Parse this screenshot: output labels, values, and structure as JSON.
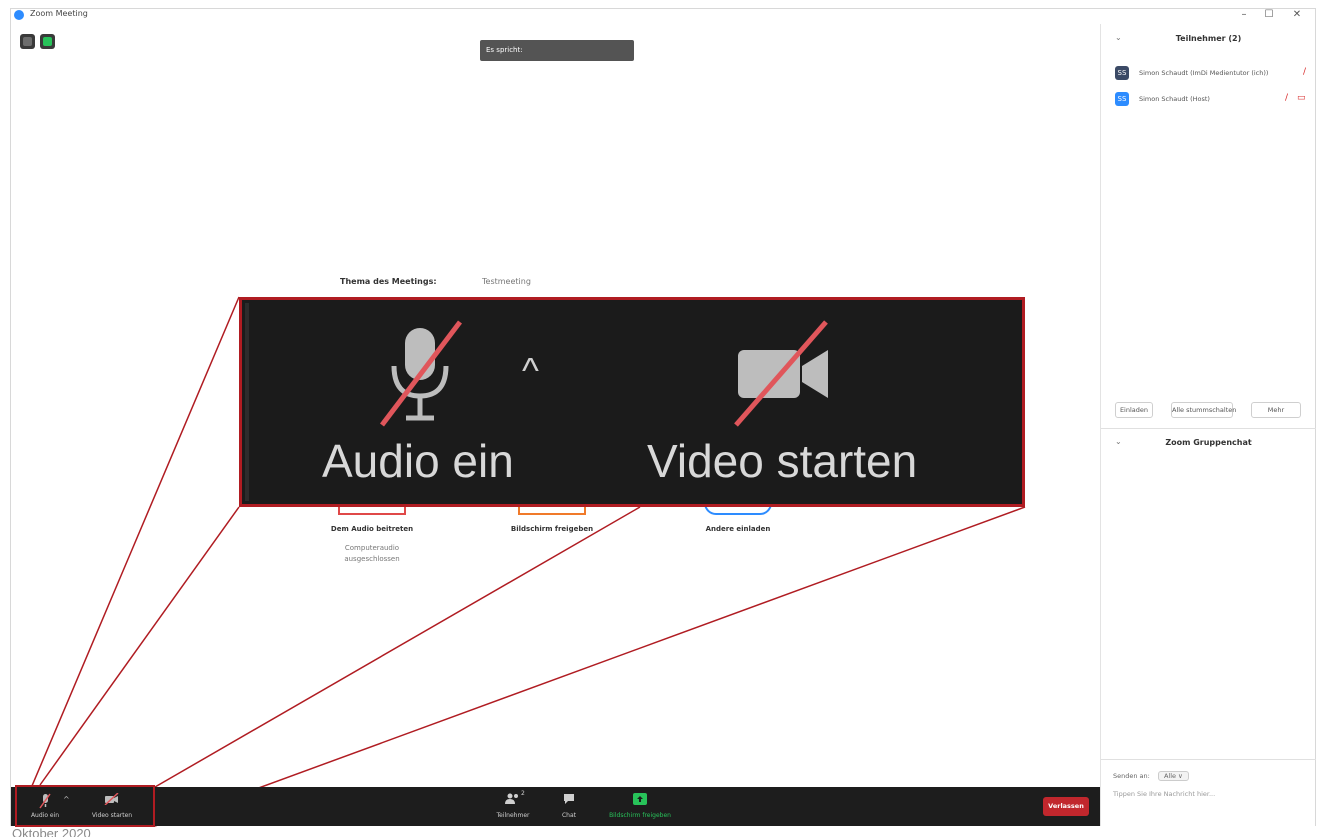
{
  "window": {
    "title": "Zoom Meeting",
    "controls": {
      "minimize": "–",
      "maximize": "☐",
      "close": "✕"
    }
  },
  "main": {
    "speaking_label": "Es spricht:",
    "topic_label": "Thema des Meetings:",
    "topic_value": "Testmeeting",
    "join_options": [
      {
        "label": "Dem Audio beitreten",
        "sub": "Computeraudio ausgeschlossen",
        "color": "#e04848"
      },
      {
        "label": "Bildschirm freigeben",
        "sub": "",
        "color": "#f07a2a"
      },
      {
        "label": "Andere einladen",
        "sub": "",
        "color": "#2d8cff"
      }
    ]
  },
  "callout": {
    "audio_label": "Audio ein",
    "video_label": "Video starten",
    "caret": "^"
  },
  "sidebar": {
    "participants_title": "Teilnehmer (2)",
    "collapse": "⌄",
    "participants": [
      {
        "initial": "SS",
        "name": "Simon Schaudt (ImDi Medientutor (ich))",
        "color": "#3b4a66"
      },
      {
        "initial": "SS",
        "name": "Simon Schaudt (Host)",
        "color": "#2d8cff"
      }
    ],
    "buttons": {
      "invite": "Einladen",
      "mute_all": "Alle stummschalten",
      "more": "Mehr"
    },
    "chat_title": "Zoom Gruppenchat",
    "send_to_label": "Senden an:",
    "send_to_value": "Alle ∨",
    "chat_placeholder": "Tippen Sie Ihre Nachricht hier..."
  },
  "toolbar": {
    "audio": "Audio ein",
    "video": "Video starten",
    "participants": "Teilnehmer",
    "participants_count": "2",
    "chat": "Chat",
    "share": "Bildschirm freigeben",
    "leave": "Verlassen"
  },
  "caption": "Oktober 2020",
  "colors": {
    "accent_red": "#b01c22",
    "toolbar_bg": "#1d1d1d",
    "share_green": "#28c35a",
    "leave_red": "#c1272d"
  }
}
